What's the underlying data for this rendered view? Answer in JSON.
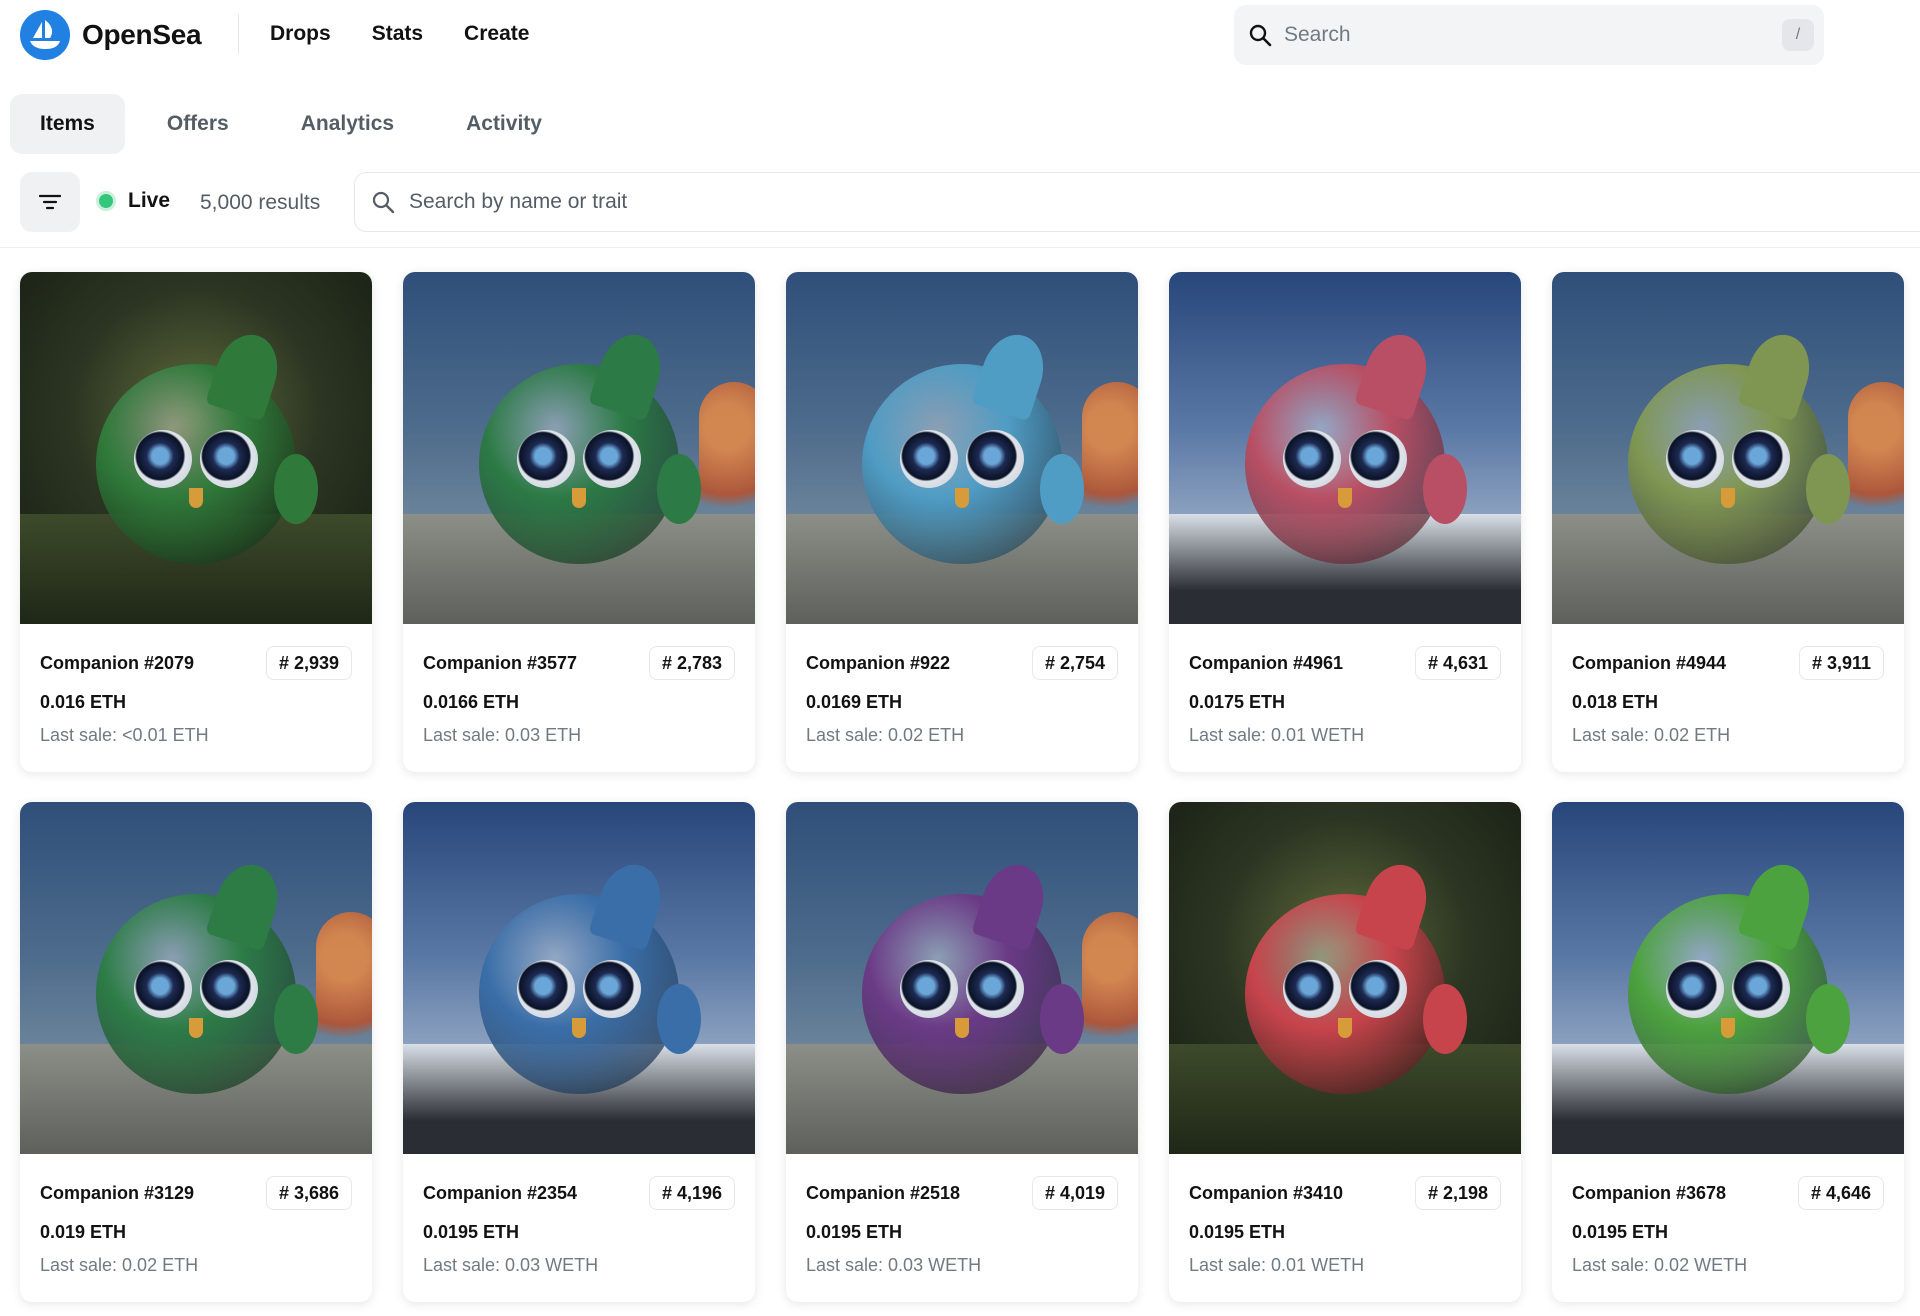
{
  "header": {
    "brand": "OpenSea",
    "nav": [
      "Drops",
      "Stats",
      "Create"
    ],
    "search_placeholder": "Search",
    "search_shortcut": "/"
  },
  "tabs": [
    {
      "label": "Items",
      "active": true
    },
    {
      "label": "Offers",
      "active": false
    },
    {
      "label": "Analytics",
      "active": false
    },
    {
      "label": "Activity",
      "active": false
    }
  ],
  "filter_bar": {
    "status": "Live",
    "results": "5,000 results",
    "search_placeholder": "Search by name or trait"
  },
  "colors": {
    "brand": "#2081e2",
    "live": "#34c77b"
  },
  "items": [
    {
      "name": "Companion #2079",
      "rank": "# 2,939",
      "price": "0.016 ETH",
      "last_sale": "Last sale: <0.01 ETH",
      "body": "#2f7a3a",
      "scene": "forest"
    },
    {
      "name": "Companion #3577",
      "rank": "# 2,783",
      "price": "0.0166 ETH",
      "last_sale": "Last sale: 0.03 ETH",
      "body": "#2c7a45",
      "scene": "reef"
    },
    {
      "name": "Companion #922",
      "rank": "# 2,754",
      "price": "0.0169 ETH",
      "last_sale": "Last sale: 0.02 ETH",
      "body": "#4f9cc4",
      "scene": "reef"
    },
    {
      "name": "Companion #4961",
      "rank": "# 4,631",
      "price": "0.0175 ETH",
      "last_sale": "Last sale: 0.01 WETH",
      "body": "#b84f64",
      "scene": "snow"
    },
    {
      "name": "Companion #4944",
      "rank": "# 3,911",
      "price": "0.018 ETH",
      "last_sale": "Last sale: 0.02 ETH",
      "body": "#7f9652",
      "scene": "reef"
    },
    {
      "name": "Companion #3129",
      "rank": "# 3,686",
      "price": "0.019 ETH",
      "last_sale": "Last sale: 0.02 ETH",
      "body": "#2d7c46",
      "scene": "reef"
    },
    {
      "name": "Companion #2354",
      "rank": "# 4,196",
      "price": "0.0195 ETH",
      "last_sale": "Last sale: 0.03 WETH",
      "body": "#3a6ea8",
      "scene": "snow"
    },
    {
      "name": "Companion #2518",
      "rank": "# 4,019",
      "price": "0.0195 ETH",
      "last_sale": "Last sale: 0.03 WETH",
      "body": "#6b3a86",
      "scene": "reef"
    },
    {
      "name": "Companion #3410",
      "rank": "# 2,198",
      "price": "0.0195 ETH",
      "last_sale": "Last sale: 0.01 WETH",
      "body": "#c8444c",
      "scene": "forest"
    },
    {
      "name": "Companion #3678",
      "rank": "# 4,646",
      "price": "0.0195 ETH",
      "last_sale": "Last sale: 0.02 WETH",
      "body": "#4ca23e",
      "scene": "snow"
    }
  ]
}
